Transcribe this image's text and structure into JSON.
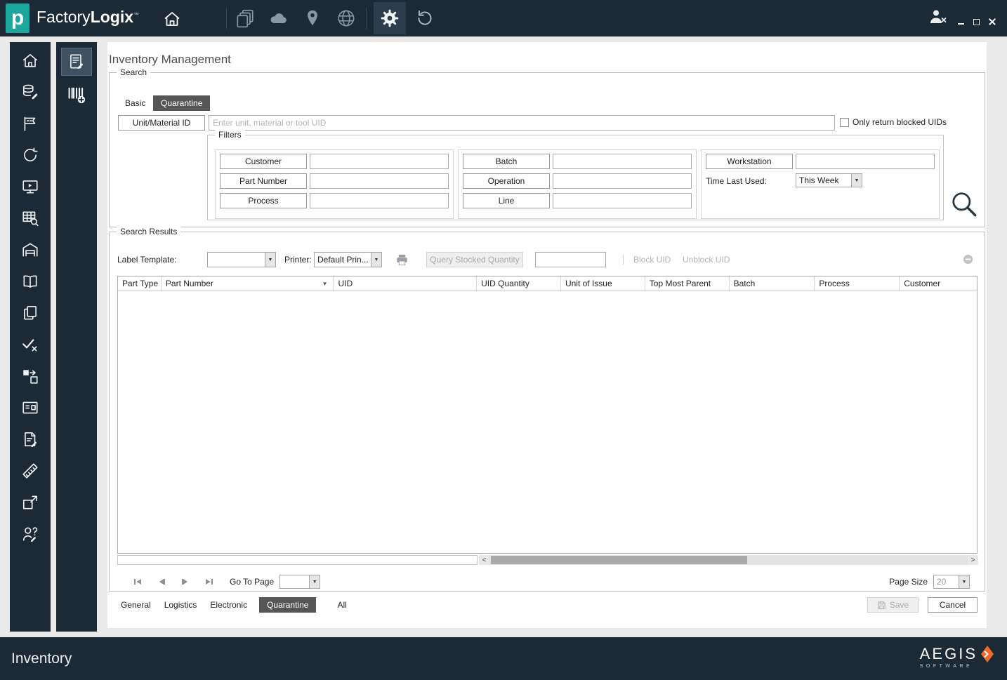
{
  "titlebar": {
    "logo_letter": "p",
    "app_name_light": "Factory",
    "app_name_bold": "Logix",
    "trademark": "™"
  },
  "main": {
    "title": "Inventory Management"
  },
  "search": {
    "group_label": "Search",
    "tabs": [
      {
        "label": "Basic"
      },
      {
        "label": "Quarantine"
      }
    ],
    "active_tab": "Quarantine",
    "unit_button_label": "Unit/Material ID",
    "unit_input_value": "",
    "unit_input_placeholder": "Enter unit, material or tool UID",
    "blocked_checkbox_label": "Only return blocked UIDs",
    "blocked_checkbox_checked": false,
    "filters": {
      "group_label": "Filters",
      "rows_col1": [
        {
          "label": "Customer",
          "value": ""
        },
        {
          "label": "Part Number",
          "value": ""
        },
        {
          "label": "Process",
          "value": ""
        }
      ],
      "rows_col2": [
        {
          "label": "Batch",
          "value": ""
        },
        {
          "label": "Operation",
          "value": ""
        },
        {
          "label": "Line",
          "value": ""
        }
      ],
      "workstation_label": "Workstation",
      "workstation_value": "",
      "time_last_used_label": "Time Last Used:",
      "time_last_used_value": "This Week"
    }
  },
  "results": {
    "group_label": "Search Results",
    "toolbar": {
      "label_template_label": "Label Template:",
      "label_template_value": "",
      "printer_label": "Printer:",
      "printer_value": "Default Prin...",
      "query_button_label": "Query Stocked Quantity",
      "quantity_value": "",
      "block_uid_label": "Block UID",
      "unblock_uid_label": "Unblock UID"
    },
    "table": {
      "columns": [
        "Part Type",
        "Part Number",
        "UID",
        "UID Quantity",
        "Unit of Issue",
        "Top Most Parent",
        "Batch",
        "Process",
        "Customer"
      ],
      "sorted_column": "Part Number",
      "rows": []
    },
    "pager": {
      "go_to_page_label": "Go To Page",
      "go_to_page_value": "",
      "page_size_label": "Page Size",
      "page_size_value": "20"
    },
    "bottom_tabs": [
      {
        "label": "General"
      },
      {
        "label": "Logistics"
      },
      {
        "label": "Electronic"
      },
      {
        "label": "Quarantine"
      },
      {
        "label": "All"
      }
    ],
    "active_bottom_tab": "Quarantine",
    "save_label": "Save",
    "cancel_label": "Cancel"
  },
  "footer": {
    "status": "Inventory",
    "brand": "AEGIS",
    "brand_sub": "SOFTWARE"
  },
  "colors": {
    "titlebar_bg": "#1c2a35",
    "accent_teal": "#1ba79d",
    "active_tab_bg": "#565656",
    "brand_orange": "#f26a2a"
  },
  "icons": {
    "titlebar": [
      "home-icon",
      "documents-icon",
      "cloud-icon",
      "location-icon",
      "globe-icon",
      "settings-gear-icon",
      "history-icon",
      "user-block-icon"
    ],
    "sidebar": [
      "home-icon",
      "materials-icon",
      "production-icon",
      "refresh-icon",
      "workstation-icon",
      "data-grid-icon",
      "warehouse-icon",
      "documentation-icon",
      "copy-icon",
      "validation-icon",
      "transfer-icon",
      "id-card-icon",
      "notes-icon",
      "design-icon",
      "shipment-icon",
      "operator-help-icon"
    ],
    "sidebar2": [
      "inventory-review-icon",
      "barcode-add-icon"
    ]
  }
}
